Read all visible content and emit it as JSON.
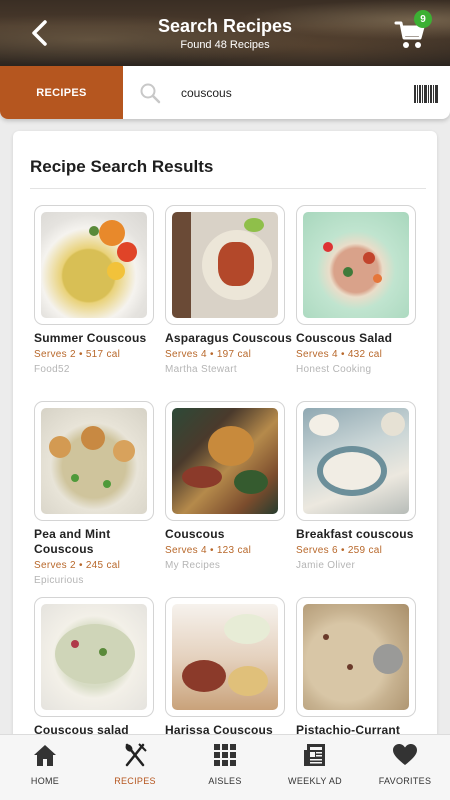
{
  "header": {
    "title": "Search Recipes",
    "subtitle": "Found 48 Recipes",
    "cart_count": "9"
  },
  "search": {
    "tab_label": "RECIPES",
    "query": "couscous"
  },
  "results": {
    "title": "Recipe Search Results",
    "items": [
      {
        "name": "Summer Couscous",
        "meta": "Serves 2 • 517 cal",
        "source": "Food52"
      },
      {
        "name": "Asparagus Couscous",
        "meta": "Serves 4 • 197 cal",
        "source": "Martha Stewart"
      },
      {
        "name": "Couscous Salad",
        "meta": "Serves 4 • 432 cal",
        "source": "Honest Cooking"
      },
      {
        "name": "Pea and Mint Couscous",
        "meta": "Serves 2 • 245 cal",
        "source": "Epicurious"
      },
      {
        "name": "Couscous",
        "meta": "Serves 4 • 123 cal",
        "source": "My Recipes"
      },
      {
        "name": "Breakfast couscous",
        "meta": "Serves 6 • 259 cal",
        "source": "Jamie Oliver"
      },
      {
        "name": "Couscous salad",
        "meta": "",
        "source": ""
      },
      {
        "name": "Harissa Couscous",
        "meta": "",
        "source": ""
      },
      {
        "name": "Pistachio-Currant",
        "meta": "",
        "source": ""
      }
    ]
  },
  "nav": {
    "home": "HOME",
    "recipes": "RECIPES",
    "aisles": "AISLES",
    "weekly_ad": "WEEKLY AD",
    "favorites": "FAVORITES"
  },
  "colors": {
    "accent": "#b5561f",
    "badge": "#3cb033",
    "meta_text": "#b8682b"
  }
}
